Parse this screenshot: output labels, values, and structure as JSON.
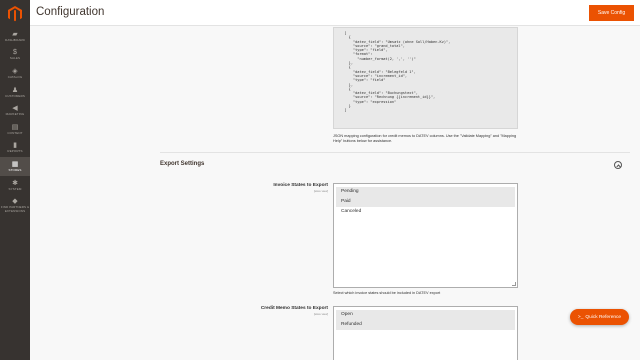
{
  "header": {
    "title": "Configuration",
    "save_label": "Save Config"
  },
  "sidebar": {
    "items": [
      {
        "label": "Dashboard",
        "icon": "dashboard-icon",
        "glyph": "▰"
      },
      {
        "label": "Sales",
        "icon": "dollar-icon",
        "glyph": "$"
      },
      {
        "label": "Catalog",
        "icon": "cube-icon",
        "glyph": "◈"
      },
      {
        "label": "Customers",
        "icon": "person-icon",
        "glyph": "♟"
      },
      {
        "label": "Marketing",
        "icon": "megaphone-icon",
        "glyph": "◀"
      },
      {
        "label": "Content",
        "icon": "layout-icon",
        "glyph": "▤"
      },
      {
        "label": "Reports",
        "icon": "bar-chart-icon",
        "glyph": "▮"
      },
      {
        "label": "Stores",
        "icon": "store-icon",
        "glyph": "▦"
      },
      {
        "label": "System",
        "icon": "gear-icon",
        "glyph": "✱"
      },
      {
        "label": "Find Partners & Extensions",
        "icon": "extensions-icon",
        "glyph": "◆"
      }
    ],
    "active_index": 7
  },
  "code_sample": "  [\n    {\n      \"datev_field\": \"Umsatz (ohne Soll/Haben-Kz)\",\n      \"source\": \"grand_total\",\n      \"type\": \"field\",\n      \"format\":\n        \"number_format(2, ',', '')\"\n    },\n    {\n      \"datev_field\": \"Belegfeld 1\",\n      \"source\": \"increment_id\",\n      \"type\": \"field\"\n    },\n    {\n      \"datev_field\": \"Buchungstext\",\n      \"source\": \"Rechnung {{increment_id}}\",\n      \"type\": \"expression\"\n    }\n  ]",
  "mapping_note": "JSON mapping configuration for credit memos to DATEV columns. Use the \"Validate Mapping\" and \"Mapping Help\" buttons below for assistance.",
  "export_settings": {
    "title": "Export Settings",
    "invoice_states": {
      "label": "Invoice States to Export",
      "scope": "[store view]",
      "options": [
        {
          "label": "Pending",
          "selected": true
        },
        {
          "label": "Paid",
          "selected": true
        },
        {
          "label": "Canceled",
          "selected": false
        }
      ],
      "hint": "Select which invoice states should be included in DATEV export"
    },
    "credit_memo_states": {
      "label": "Credit Memo States to Export",
      "scope": "[store view]",
      "options": [
        {
          "label": "Open",
          "selected": true
        },
        {
          "label": "Refunded",
          "selected": true
        }
      ]
    }
  },
  "quick_reference": {
    "glyph": ">_",
    "label": "Quick Reference"
  },
  "colors": {
    "accent": "#eb5202",
    "sidebar_bg": "#373330",
    "sidebar_active": "#524d49"
  }
}
